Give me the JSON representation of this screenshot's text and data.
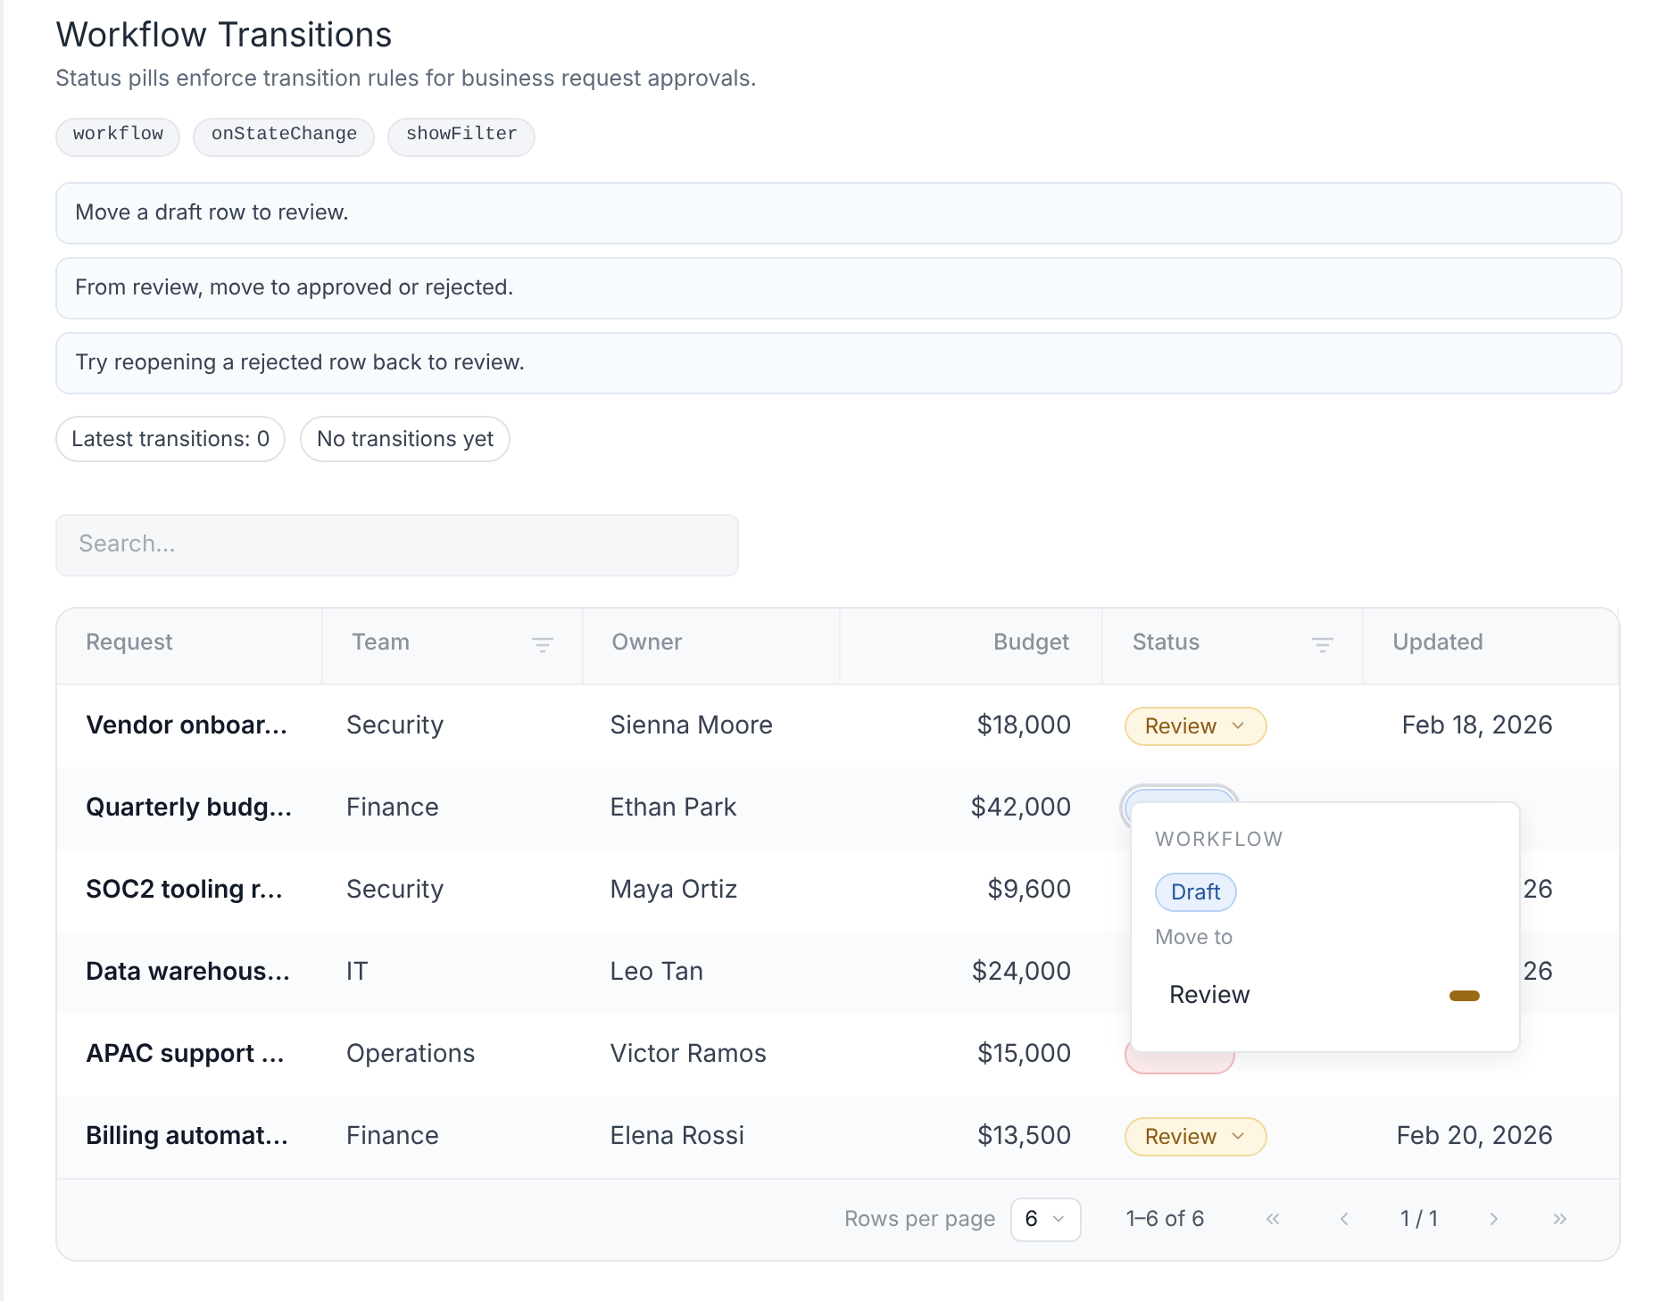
{
  "title": "Workflow Transitions",
  "subtitle": "Status pills enforce transition rules for business request approvals.",
  "tags": [
    "workflow",
    "onStateChange",
    "showFilter"
  ],
  "hints": [
    "Move a draft row to review.",
    "From review, move to approved or rejected.",
    "Try reopening a rejected row back to review."
  ],
  "counters": [
    "Latest transitions: 0",
    "No transitions yet"
  ],
  "search": {
    "placeholder": "Search..."
  },
  "table": {
    "columns": [
      {
        "label": "Request",
        "filter": false
      },
      {
        "label": "Team",
        "filter": true
      },
      {
        "label": "Owner",
        "filter": false
      },
      {
        "label": "Budget",
        "filter": false
      },
      {
        "label": "Status",
        "filter": true
      },
      {
        "label": "Updated",
        "filter": false
      }
    ],
    "rows": [
      {
        "request": "Vendor onboar...",
        "team": "Security",
        "owner": "Sienna Moore",
        "budget": "$18,000",
        "status": {
          "label": "Review",
          "kind": "review",
          "focused": false
        },
        "updated": "Feb 18, 2026"
      },
      {
        "request": "Quarterly budg...",
        "team": "Finance",
        "owner": "Ethan Park",
        "budget": "$42,000",
        "status": {
          "kind": "draft",
          "focused": true
        }
      },
      {
        "request": "SOC2 tooling r...",
        "team": "Security",
        "owner": "Maya Ortiz",
        "budget": "$9,600",
        "updated": "26"
      },
      {
        "request": "Data warehous...",
        "team": "IT",
        "owner": "Leo Tan",
        "budget": "$24,000",
        "updated": "26"
      },
      {
        "request": "APAC support ...",
        "team": "Operations",
        "owner": "Victor Ramos",
        "budget": "$15,000",
        "status": {
          "kind": "rejected",
          "focused": false
        }
      },
      {
        "request": "Billing automat...",
        "team": "Finance",
        "owner": "Elena Rossi",
        "budget": "$13,500",
        "status": {
          "label": "Review",
          "kind": "review",
          "focused": false
        },
        "updated": "Feb 20, 2026"
      }
    ]
  },
  "popover": {
    "heading": "WORKFLOW",
    "current": {
      "label": "Draft",
      "kind": "draft"
    },
    "move_label": "Move to",
    "options": [
      {
        "label": "Review",
        "color": "#9a6a16"
      }
    ]
  },
  "footer": {
    "rows_per_page_label": "Rows per page",
    "rows_per_page": "6",
    "range": "1–6 of 6",
    "page": "1 / 1"
  }
}
